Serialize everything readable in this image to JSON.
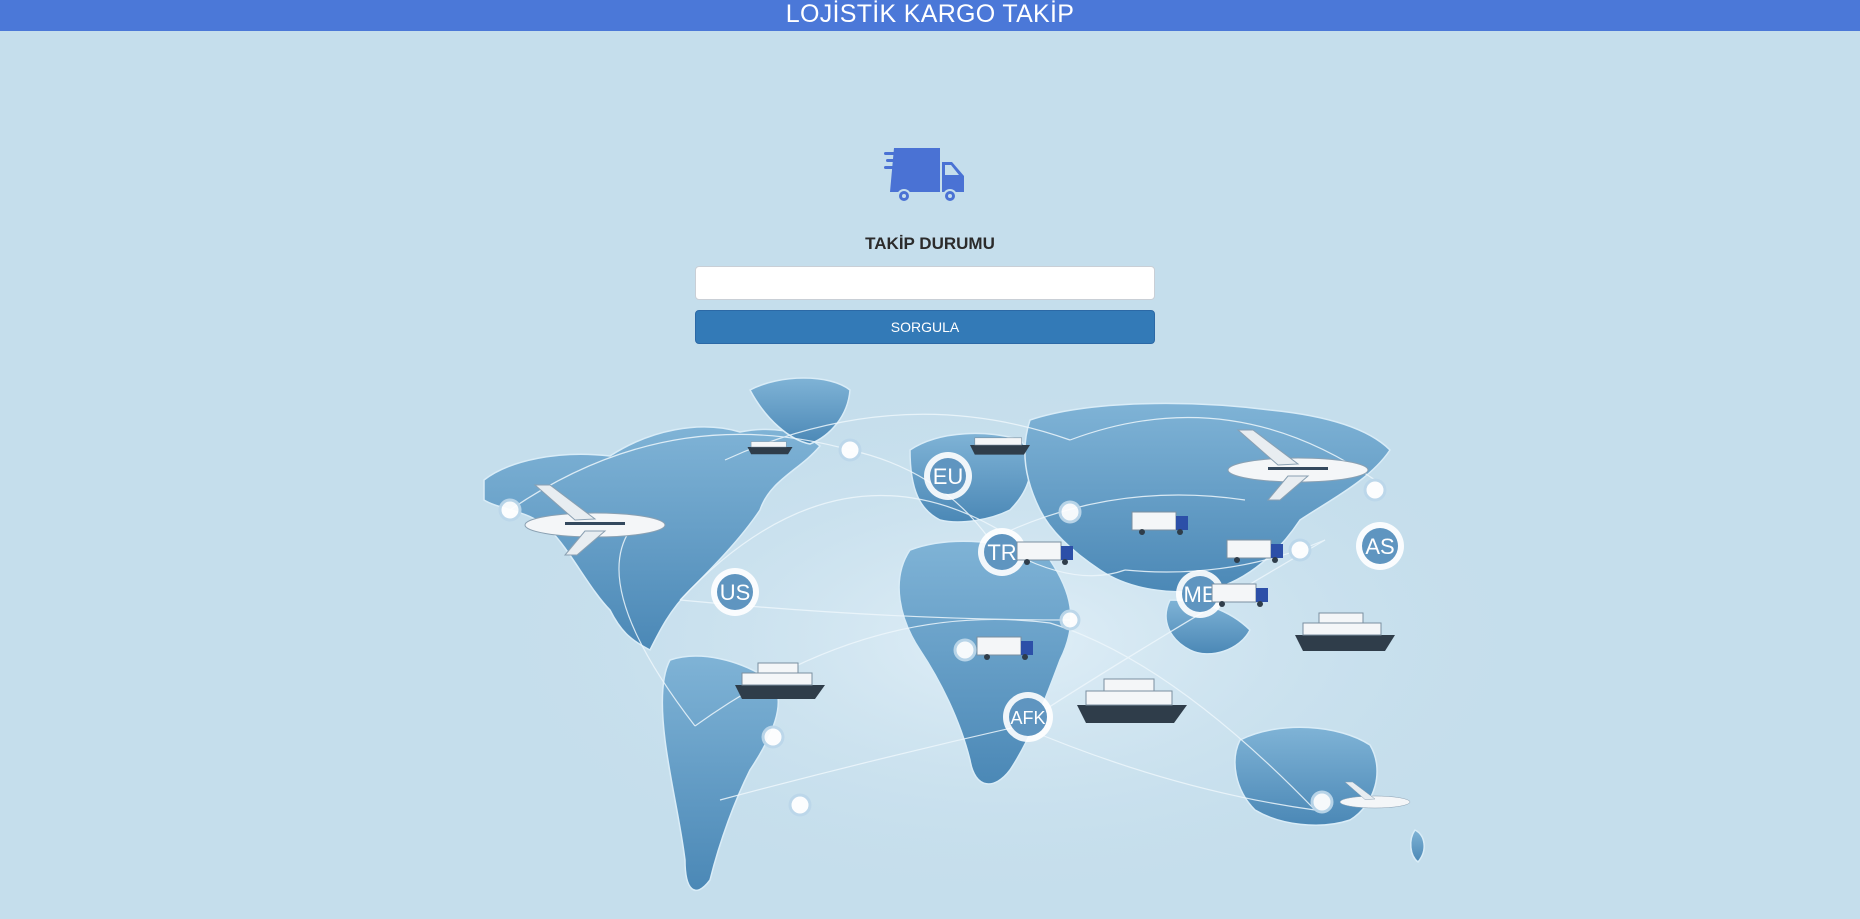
{
  "header": {
    "title": "LOJİSTİK KARGO TAKİP"
  },
  "tracking": {
    "title": "TAKİP DURUMU",
    "input_value": "",
    "input_placeholder": "",
    "button_label": "SORGULA"
  },
  "map": {
    "region_labels": [
      "US",
      "EU",
      "TR",
      "ME",
      "AS",
      "AFK"
    ]
  },
  "colors": {
    "header_bg": "#4b78d8",
    "page_bg": "#c5deec",
    "button_bg": "#337ab7",
    "truck_icon": "#4a72d4"
  },
  "icons": {
    "logo": "delivery-truck-icon"
  }
}
